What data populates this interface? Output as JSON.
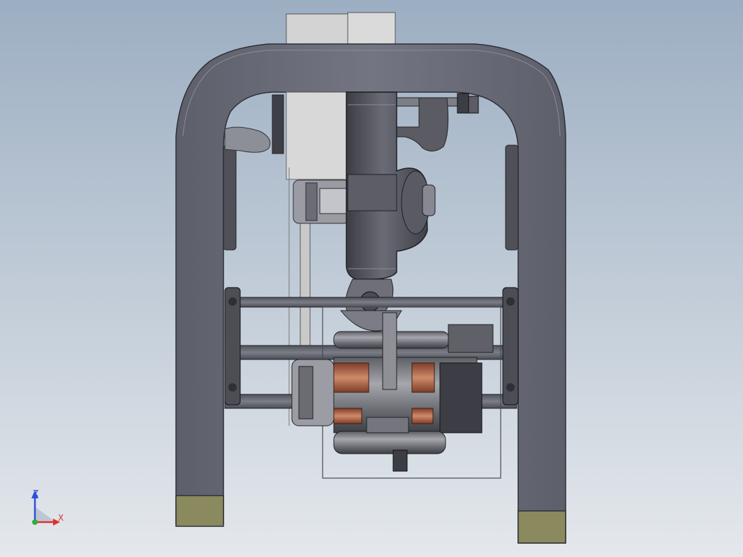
{
  "colors": {
    "background_top": "#9eafc2",
    "background_bottom": "#e3e7eb",
    "frame": "#6b6d78",
    "frame_dark": "#3b3d45",
    "foot": "#8c8c60",
    "housing": "#55565f",
    "panel": "#d6d6d6",
    "copper": "#b66a4c",
    "axis_x": "#e03030",
    "axis_z": "#2f4fd8",
    "axis_origin": "#2fae3c"
  },
  "triad": {
    "z_label": "Z",
    "x_label": "X"
  },
  "icons": [
    "view-triad-icon"
  ]
}
